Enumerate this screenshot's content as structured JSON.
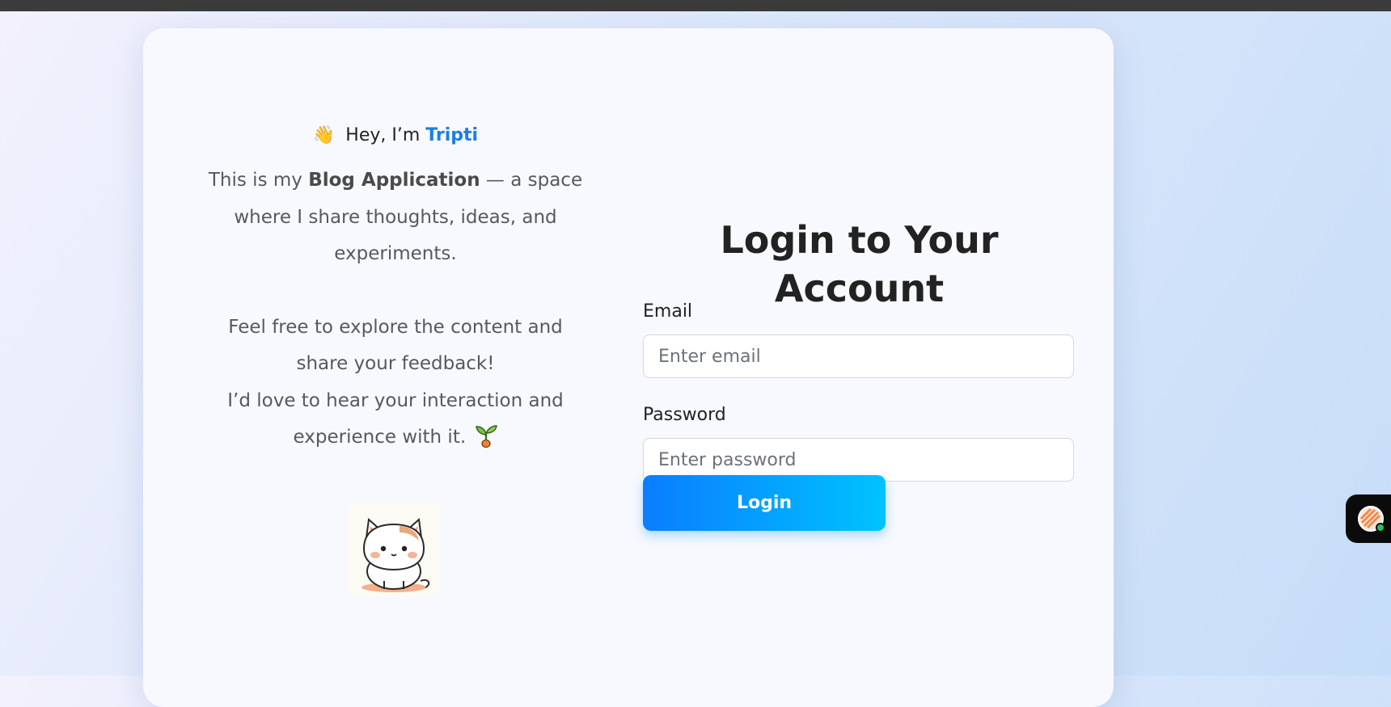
{
  "intro": {
    "greeting_prefix": "Hey, I’m",
    "greeting_name": "Tripti",
    "para1_before": "This is my",
    "para1_bold": "Blog Application",
    "para1_after": "— a space where I share thoughts, ideas, and experiments.",
    "para2_line1": "Feel free to explore the content and share your feedback!",
    "para2_line2": "I’d love to hear your interaction and experience with it."
  },
  "login": {
    "title": "Login to Your Account",
    "email_label": "Email",
    "email_placeholder": "Enter email",
    "password_label": "Password",
    "password_placeholder": "Enter password",
    "button_label": "Login"
  },
  "icons": {
    "wave": "waving-hand-emoji",
    "sprout": "seedling-emoji",
    "cat": "cat-sticker",
    "widget": "chat-assistant-widget-icon"
  },
  "colors": {
    "accent": "#1a7fe6",
    "button_start": "#0a7dff",
    "button_end": "#00c3ff",
    "online_status": "#22c55e"
  }
}
